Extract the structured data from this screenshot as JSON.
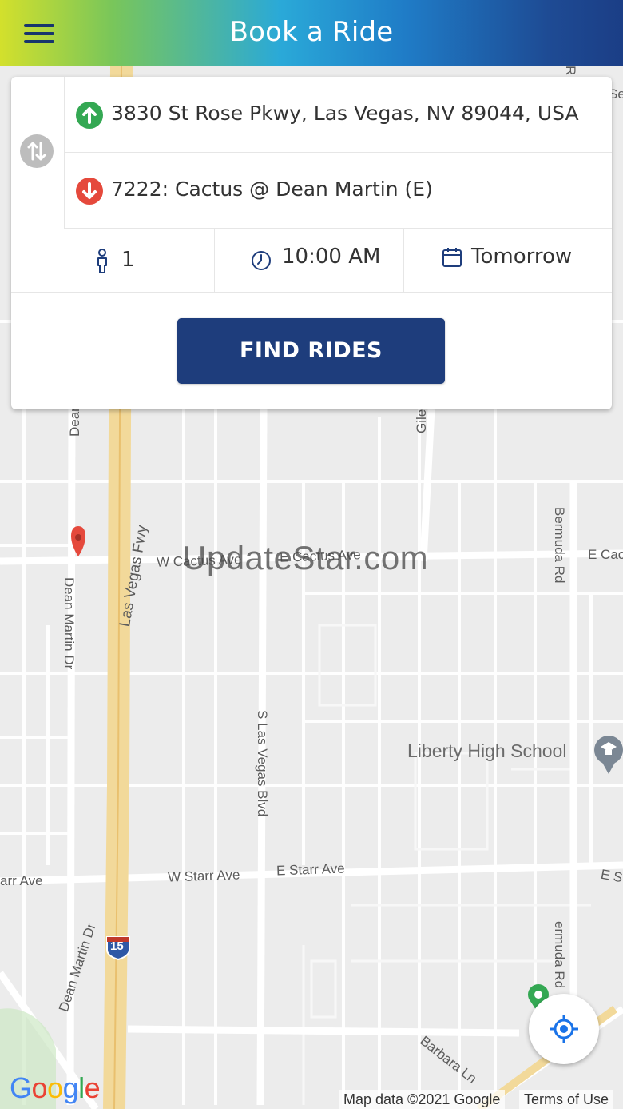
{
  "header": {
    "title": "Book a Ride",
    "menu_icon": "hamburger-menu-icon"
  },
  "booking": {
    "swap_icon": "swap-vertical-icon",
    "origin": {
      "icon": "arrow-up-circle-icon",
      "text": "3830 St Rose Pkwy, Las Vegas, NV 89044, USA"
    },
    "destination": {
      "icon": "arrow-down-circle-icon",
      "text": "7222: Cactus @ Dean Martin (E)"
    },
    "riders": {
      "icon": "person-icon",
      "value": "1"
    },
    "time": {
      "icon": "clock-icon",
      "value": "10:00 AM"
    },
    "date": {
      "icon": "calendar-icon",
      "value": "Tomorrow"
    },
    "find_button": "FIND RIDES"
  },
  "map": {
    "labels": {
      "dean_top": "Dean",
      "gile": "Gile",
      "bermuda_rd_top": "Bermuda Rd",
      "las_vegas_fwy": "Las Vegas Fwy",
      "w_cactus_ave": "W Cactus Ave",
      "e_cactus_ave": "E Cactus Ave",
      "e_cac": "E Cac",
      "dean_martin_dr": "Dean Martin Dr",
      "s_las_vegas_blvd": "S Las Vegas Blvd",
      "liberty_high_school": "Liberty High School",
      "arr_ave": "arr Ave",
      "w_starr_ave": "W Starr Ave",
      "e_starr_ave": "E Starr Ave",
      "e_s": "E S",
      "interstate": "15",
      "dean_martin_dr_bottom": "Dean Martin Dr",
      "bermuda_rd_bottom": "ermuda Rd",
      "barbara_ln": "Barbara Ln",
      "top_r": "R",
      "top_se": "Se"
    },
    "colors": {
      "background": "#ececec",
      "road": "#ffffff",
      "freeway": "#f2d99a",
      "pin_red": "#e5493c",
      "pin_green": "#34a853"
    }
  },
  "watermark": "UpdateStar.com",
  "locate_icon": "my-location-icon",
  "attribution": {
    "logo": [
      "G",
      "o",
      "o",
      "g",
      "l",
      "e"
    ],
    "map_data": "Map data ©2021 Google",
    "terms": "Terms of Use"
  }
}
